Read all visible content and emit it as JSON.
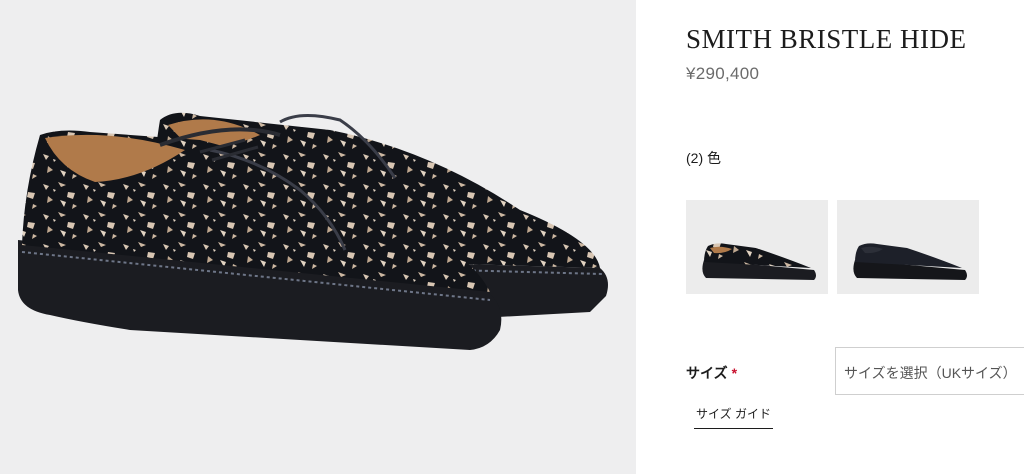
{
  "product": {
    "title": "SMITH BRISTLE HIDE",
    "price": "¥290,400"
  },
  "colors": {
    "label": "(2) 色",
    "swatches": [
      {
        "name": "bristle-hide"
      },
      {
        "name": "black"
      }
    ]
  },
  "size": {
    "label": "サイズ",
    "required_mark": "*",
    "select_value": "サイズを選択（UKサイズ）",
    "guide_label": "サイズ ガイド"
  },
  "palette": {
    "panel_background": "#eeeeef",
    "shoe_sole": "#1b1c21",
    "shoe_upper": "#121419",
    "speckle": "#d8c6b3",
    "lining": "#b07a4a",
    "required_red": "#c8102e"
  }
}
